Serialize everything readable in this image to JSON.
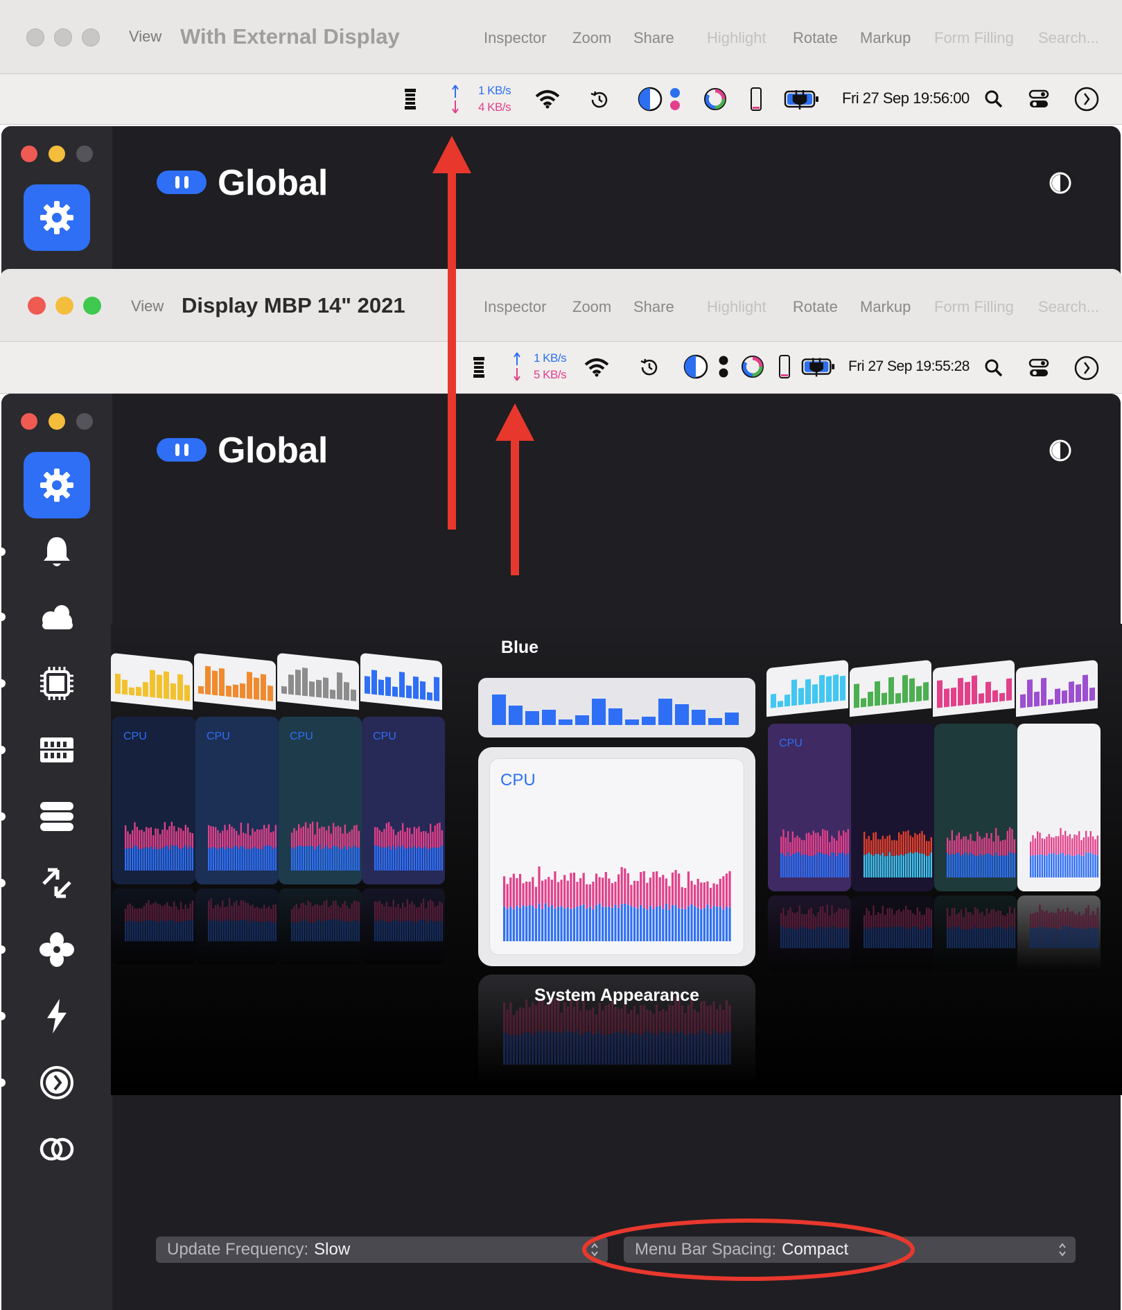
{
  "top_window": {
    "view_label": "View",
    "title": "With External Display",
    "toolbar": [
      "Inspector",
      "Zoom",
      "Share",
      "Highlight",
      "Rotate",
      "Markup",
      "Form Filling",
      "Search..."
    ],
    "menubar": {
      "net_up": "1 KB/s",
      "net_down": "4 KB/s",
      "datetime": "Fri 27 Sep 19:56:00"
    }
  },
  "second_window": {
    "view_label": "View",
    "title": "Display MBP 14\" 2021",
    "toolbar": [
      "Inspector",
      "Zoom",
      "Share",
      "Highlight",
      "Rotate",
      "Markup",
      "Form Filling",
      "Search..."
    ],
    "menubar": {
      "net_up": "1 KB/s",
      "net_down": "5 KB/s",
      "datetime": "Fri 27 Sep 19:55:28"
    }
  },
  "app": {
    "section_title": "Global",
    "sidebar_icons": [
      "gear-icon",
      "bell-icon",
      "cloud-icon",
      "chip-icon",
      "memory-icon",
      "disk-icon",
      "network-icon",
      "fan-icon",
      "bolt-icon",
      "clock-icon",
      "link-rings-icon"
    ],
    "theme_label": "Blue",
    "center_card_label": "CPU",
    "appearance_label": "System Appearance",
    "mini_card_label": "CPU",
    "update_frequency": {
      "label": "Update Frequency:",
      "value": "Slow"
    },
    "menu_bar_spacing": {
      "label": "Menu Bar Spacing:",
      "value": "Compact"
    }
  },
  "colors": {
    "accent": "#2e6ff5",
    "annotation": "#e8382d",
    "net_up": "#2c6ff0",
    "net_down": "#e2408a"
  }
}
